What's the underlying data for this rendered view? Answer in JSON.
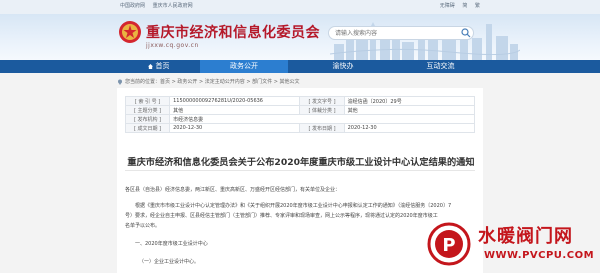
{
  "topbar": {
    "left_links": [
      "中国政府网",
      "重庆市人民政府网"
    ],
    "right_links": [
      "无障碍",
      "简",
      "繁"
    ]
  },
  "header": {
    "site_title": "重庆市经济和信息化委员会",
    "site_domain": "jjxxw.cq.gov.cn",
    "search_placeholder": "请输入搜索内容"
  },
  "nav": {
    "items": [
      {
        "label": "首页"
      },
      {
        "label": "政务公开"
      },
      {
        "label": "渝快办"
      },
      {
        "label": "互动交流"
      }
    ],
    "active_index": 1
  },
  "breadcrumb": {
    "text": "您当前的位置：首页 > 政务公开 > 法定主动公开内容 > 部门文件 > 其他公文"
  },
  "meta": {
    "rows": [
      {
        "k1": "[ 索 引 号 ]",
        "v1": "11500000009276281U/2020-05636",
        "k2": "[ 发文字号 ]",
        "v2": "渝经信函〔2020〕29号"
      },
      {
        "k1": "[ 主题分类 ]",
        "v1": "其他",
        "k2": "[ 体裁分类 ]",
        "v2": "其他"
      },
      {
        "k1": "[ 发布机构 ]",
        "v1": "市经济信息委",
        "k2": "",
        "v2": ""
      },
      {
        "k1": "[ 成文日期 ]",
        "v1": "2020-12-30",
        "k2": "[ 发布日期 ]",
        "v2": "2020-12-30"
      }
    ]
  },
  "article": {
    "title": "重庆市经济和信息化委员会关于公布2020年度重庆市级工业设计中心认定结果的通知",
    "paragraphs": [
      "各区县（自治县）经济信息委，两江新区、重庆高新区、万盛经开区经信部门，有关单位及企业：",
      "根据《重庆市市级工业设计中心认定管理办法》和《关于组织开展2020年度市级工业设计中心申报和认定工作的通知》（渝经信服务〔2020〕7",
      "号）要求，经企业自主申报、区县经信主管部门（主管部门）推荐、专家评审和现场审查，网上公示等程序，现将通过认定的2020年度市级工",
      "名单予以公布。",
      "一、2020年度市级工业设计中心",
      "（一）企业工业设计中心。"
    ]
  },
  "watermark": {
    "text": "水暖阀门网",
    "url": "WWW.PVCPU.COM",
    "badge_letter": "P"
  },
  "colors": {
    "nav_bg": "#1b5a9e",
    "nav_active": "#2c7ed0",
    "brand_red": "#b5192a",
    "watermark_red": "#c4161c"
  }
}
